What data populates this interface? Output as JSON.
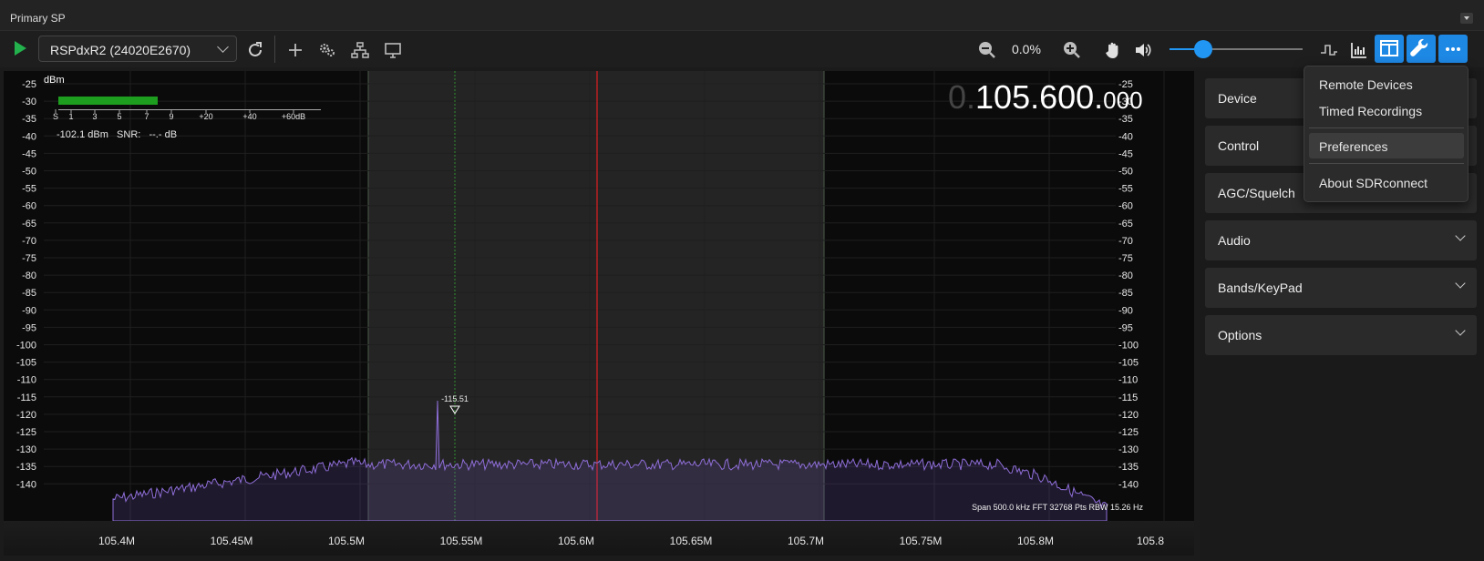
{
  "window": {
    "title": "Primary SP"
  },
  "toolbar": {
    "device_label": "RSPdxR2 (24020E2670)",
    "zoom_value": "0.0%",
    "volume_level": 0.25
  },
  "display": {
    "frequency": {
      "dim_prefix": "0.",
      "main": "105.600.",
      "small": "000"
    },
    "smeter": {
      "unit": "dBm",
      "scale_labels": [
        "S",
        "1",
        "3",
        "5",
        "7",
        "9",
        "+20",
        "+40",
        "+60dB"
      ],
      "readout": "-102.1 dBm   SNR:   --.- dB"
    },
    "peak_label": "-115.51",
    "footer": "Span 500.0 kHz FFT 32768 Pts  RBW 15.26 Hz",
    "y_ticks": [
      "-25",
      "-30",
      "-35",
      "-40",
      "-45",
      "-50",
      "-55",
      "-60",
      "-65",
      "-70",
      "-75",
      "-80",
      "-85",
      "-90",
      "-95",
      "-100",
      "-105",
      "-110",
      "-115",
      "-120",
      "-125",
      "-130",
      "-135",
      "-140"
    ],
    "x_ticks": [
      "105.4M",
      "105.45M",
      "105.5M",
      "105.55M",
      "105.6M",
      "105.65M",
      "105.7M",
      "105.75M",
      "105.8M",
      "105.8"
    ]
  },
  "panels": [
    {
      "label": "Device"
    },
    {
      "label": "Control"
    },
    {
      "label": "AGC/Squelch"
    },
    {
      "label": "Audio"
    },
    {
      "label": "Bands/KeyPad"
    },
    {
      "label": "Options"
    }
  ],
  "menu": {
    "items": [
      "Remote Devices",
      "Timed Recordings",
      "Preferences",
      "About SDRconnect"
    ]
  },
  "colors": {
    "accent": "#1e88e5",
    "play": "#22b14c",
    "trace": "#8e6ed8",
    "center_line": "#e02020"
  }
}
